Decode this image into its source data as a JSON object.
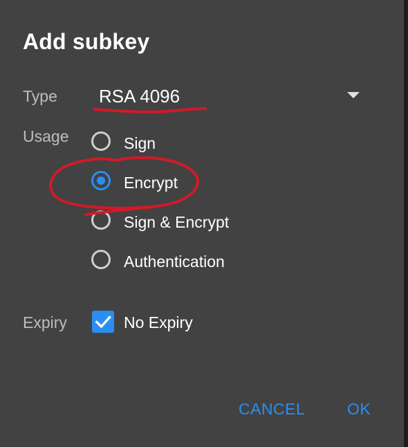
{
  "dialog": {
    "title": "Add subkey"
  },
  "type_row": {
    "label": "Type",
    "selected_value": "RSA 4096",
    "dropdown_icon": "dropdown-arrow-icon"
  },
  "usage_row": {
    "label": "Usage",
    "options": [
      {
        "label": "Sign",
        "checked": false
      },
      {
        "label": "Encrypt",
        "checked": true
      },
      {
        "label": "Sign & Encrypt",
        "checked": false
      },
      {
        "label": "Authentication",
        "checked": false
      }
    ]
  },
  "expiry_row": {
    "label": "Expiry",
    "checkbox_label": "No Expiry",
    "checked": true
  },
  "actions": {
    "cancel_label": "CANCEL",
    "ok_label": "OK"
  },
  "colors": {
    "dialog_background": "#424242",
    "accent": "#2a8ff0",
    "annotation_ink": "#d11a2a"
  }
}
